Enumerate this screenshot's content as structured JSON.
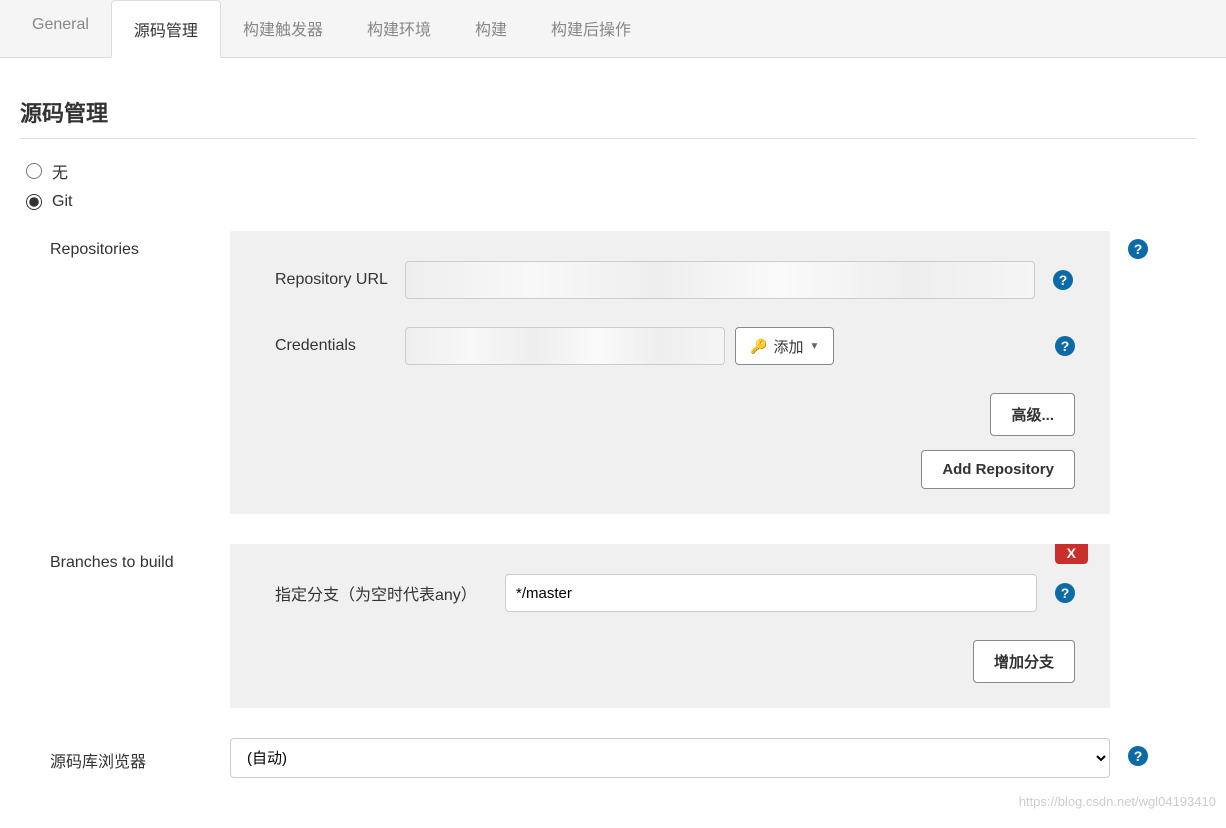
{
  "tabs": {
    "general": "General",
    "scm": "源码管理",
    "triggers": "构建触发器",
    "env": "构建环境",
    "build": "构建",
    "post": "构建后操作"
  },
  "section_title": "源码管理",
  "scm": {
    "none_label": "无",
    "git_label": "Git"
  },
  "repos": {
    "side_label": "Repositories",
    "url_label": "Repository URL",
    "url_value": "",
    "cred_label": "Credentials",
    "cred_value": "",
    "add_cred": "添加",
    "advanced_btn": "高级...",
    "add_repo_btn": "Add Repository"
  },
  "branches": {
    "side_label": "Branches to build",
    "branch_label": "指定分支（为空时代表any）",
    "branch_value": "*/master",
    "add_branch_btn": "增加分支",
    "delete_label": "X"
  },
  "browser": {
    "side_label": "源码库浏览器",
    "value": "(自动)"
  },
  "watermark": "https://blog.csdn.net/wgl04193410"
}
